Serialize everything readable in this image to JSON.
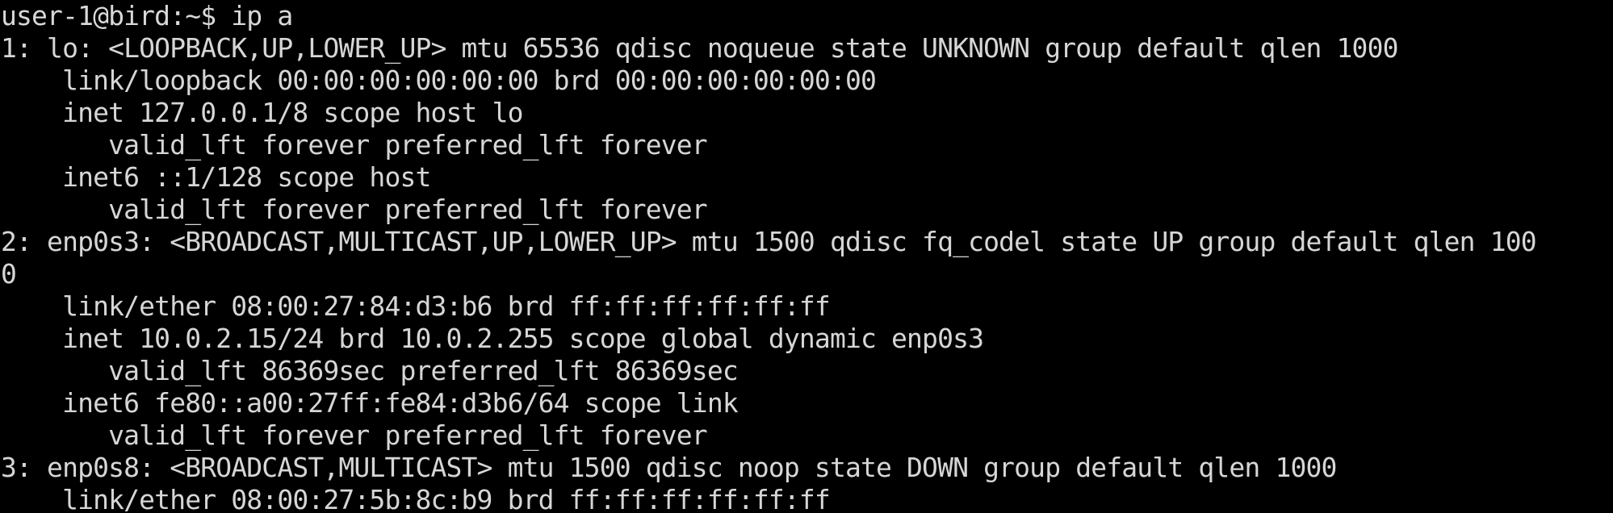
{
  "terminal": {
    "prompt": "user-1@bird:~$ ip a",
    "lines": [
      "1: lo: <LOOPBACK,UP,LOWER_UP> mtu 65536 qdisc noqueue state UNKNOWN group default qlen 1000",
      "    link/loopback 00:00:00:00:00:00 brd 00:00:00:00:00:00",
      "    inet 127.0.0.1/8 scope host lo",
      "       valid_lft forever preferred_lft forever",
      "    inet6 ::1/128 scope host",
      "       valid_lft forever preferred_lft forever",
      "2: enp0s3: <BROADCAST,MULTICAST,UP,LOWER_UP> mtu 1500 qdisc fq_codel state UP group default qlen 100",
      "0",
      "    link/ether 08:00:27:84:d3:b6 brd ff:ff:ff:ff:ff:ff",
      "    inet 10.0.2.15/24 brd 10.0.2.255 scope global dynamic enp0s3",
      "       valid_lft 86369sec preferred_lft 86369sec",
      "    inet6 fe80::a00:27ff:fe84:d3b6/64 scope link",
      "       valid_lft forever preferred_lft forever",
      "3: enp0s8: <BROADCAST,MULTICAST> mtu 1500 qdisc noop state DOWN group default qlen 1000",
      "    link/ether 08:00:27:5b:8c:b9 brd ff:ff:ff:ff:ff:ff"
    ]
  },
  "colors": {
    "background": "#000000",
    "foreground": "#d6d6d6"
  }
}
